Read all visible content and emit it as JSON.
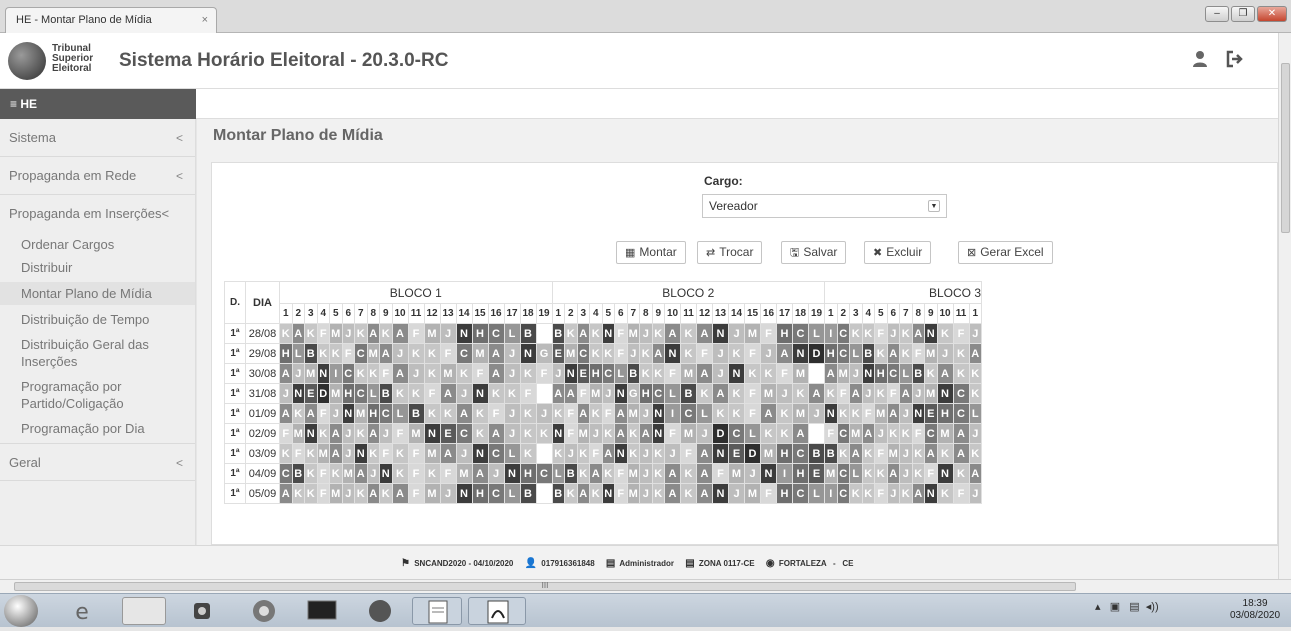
{
  "browser": {
    "tab_title": "HE - Montar Plano de Mídia",
    "tab_close": "×",
    "win_minimize": "–",
    "win_restore": "❐",
    "win_close": "✕"
  },
  "header": {
    "logo_line1": "Tribunal",
    "logo_line2": "Superior",
    "logo_line3": "Eleitoral",
    "app_title": "Sistema Horário Eleitoral - 20.3.0-RC",
    "user_icon": "user-icon",
    "logout_icon": "logout-icon"
  },
  "navbar": {
    "brand": "≡ HE"
  },
  "sidebar": {
    "chevron": "<",
    "items": [
      {
        "label": "Sistema"
      },
      {
        "label": "Propaganda em Rede"
      },
      {
        "label": "Propaganda em Inserções"
      }
    ],
    "subitems": [
      {
        "label": "Ordenar Cargos"
      },
      {
        "label": "Distribuir"
      },
      {
        "label": "Montar Plano de Mídia"
      },
      {
        "label": "Distribuição de Tempo"
      },
      {
        "label": "Distribuição Geral das Inserções"
      },
      {
        "label": "Programação por Partido/Coligação"
      },
      {
        "label": "Programação por Dia"
      }
    ],
    "geral": {
      "label": "Geral"
    }
  },
  "main": {
    "page_title": "Montar Plano de Mídia",
    "cargo_label": "Cargo:",
    "cargo_value": "Vereador",
    "buttons": {
      "montar": "Montar",
      "trocar": "Trocar",
      "salvar": "Salvar",
      "excluir": "Excluir",
      "gerar_excel": "Gerar Excel"
    }
  },
  "grid": {
    "headers": {
      "d": "D.",
      "dia": "DIA"
    },
    "blocos": [
      "BLOCO 1",
      "BLOCO 2",
      "BLOCO 3"
    ],
    "bloco3_numbers": [
      "1",
      "2",
      "3",
      "4",
      "5",
      "6",
      "7",
      "8",
      "9",
      "10",
      "11",
      "1"
    ],
    "colors": {
      "K": "#c6c6c6",
      "F": "#d8d8d8",
      "A": "#8a8a8a",
      "M": "#b2b2b2",
      "J": "#bdbdbd",
      "N": "#3c3c3c",
      "H": "#6e6e6e",
      "C": "#787878",
      "L": "#969696",
      "B": "#4a4a4a",
      "E": "#5a5a5a",
      "D": "#2e2e2e",
      "I": "#9a9a9a",
      "G": "#bababa"
    },
    "rows": [
      {
        "d": "1ª",
        "dia": "28/08",
        "b1": "KAKFMJKAKAFMJNHCLB_",
        "b2": "BKAKNFMJKAKANJMFHCL",
        "b3": "ICKKFJKANKFJ"
      },
      {
        "d": "1ª",
        "dia": "29/08",
        "b1": "HLBKKFCMAJKKFCMAJNG",
        "b2": "EMCKKFJKANKFJKFJAND",
        "b3": "HCLBKAKFMJKA"
      },
      {
        "d": "1ª",
        "dia": "30/08",
        "b1": "AJMNICKKFAJKMKFAJKF",
        "b2": "JNEHCLBKKFMAJNKKFM_",
        "b3": "AMJNHCLBKAKK"
      },
      {
        "d": "1ª",
        "dia": "31/08",
        "b1": "JNEDMHCLBKKFAJNKKF_",
        "b2": "AAFMJNGHCLBKAKFMJKA",
        "b3": "KFAJKFAJMNCK"
      },
      {
        "d": "1ª",
        "dia": "01/09",
        "b1": "AKAFJNMHCLBKKAKFJKJ",
        "b2": "KFAKFAMJNICLKKFAKMJ",
        "b3": "NKKFMAJNEHCL"
      },
      {
        "d": "1ª",
        "dia": "02/09",
        "b1": "FMNKAJKAJFMNECKAJKK",
        "b2": "NFMJKAKANFMJDCLKKA_",
        "b3": "FCMAJKKFCMAJ"
      },
      {
        "d": "1ª",
        "dia": "03/09",
        "b1": "KFKMAJNKFKFMAJNCLK_",
        "b2": "KJKFANKJKJFANEDMHCB",
        "b3": "BKAKFMJKAKAK"
      },
      {
        "d": "1ª",
        "dia": "04/09",
        "b1": "CBKFKMAJNKFKFMAJNHC",
        "b2": "LBKAKFMJKAKAFMJNIHE",
        "b3": "MCLKKAJKFNKA"
      },
      {
        "d": "1ª",
        "dia": "05/09",
        "b1": "AKKFMJKAKAFMJNHCLB_",
        "b2": "BKAKNFMJKAKANJMFHCL",
        "b3": "ICKKFJKANKFJ"
      }
    ]
  },
  "statusbar": {
    "flag_icon": "⚑",
    "session": "SNCAND2020 - 04/10/2020",
    "user_icon": "👤",
    "user": "017916361848",
    "profile_icon": "▤",
    "profile": "Administrador",
    "zone_icon": "▤",
    "zone": "ZONA 0117-CE",
    "globe_icon": "◉",
    "city": "FORTALEZA   -   CE"
  },
  "hscroll_label": "III",
  "taskbar": {
    "time": "18:39",
    "date": "03/08/2020"
  }
}
